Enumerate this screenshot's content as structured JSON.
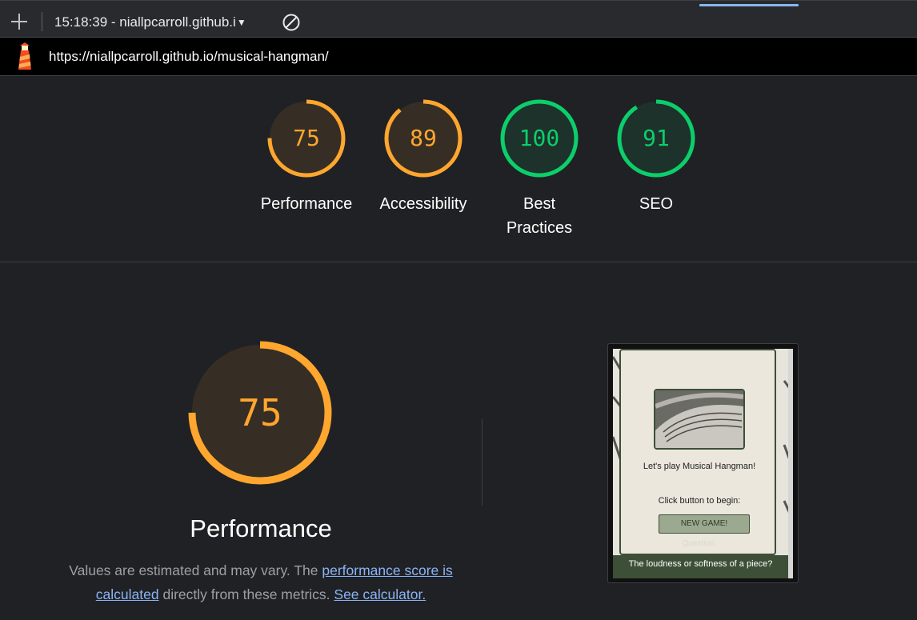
{
  "toolbar": {
    "report_select": "15:18:39 - niallpcarroll.github.i",
    "colors": {
      "accent": "#8ab4f8"
    }
  },
  "urlbar": {
    "url": "https://niallpcarroll.github.io/musical-hangman/"
  },
  "gauges": [
    {
      "score": "75",
      "label": "Performance",
      "color": "#ffa62f",
      "fraction": 0.75
    },
    {
      "score": "89",
      "label": "Accessibility",
      "color": "#ffa62f",
      "fraction": 0.89
    },
    {
      "score": "100",
      "label": "Best Practices",
      "color": "#0cce6b",
      "fraction": 1.0
    },
    {
      "score": "91",
      "label": "SEO",
      "color": "#0cce6b",
      "fraction": 0.91
    }
  ],
  "performance": {
    "score": "75",
    "fraction": 0.75,
    "title": "Performance",
    "desc_1": "Values are estimated and may vary. The ",
    "link_score": "performance score is calculated",
    "desc_2": " directly from these metrics. ",
    "link_calculator": "See calculator."
  },
  "thumbnail": {
    "title": "Let's play Musical Hangman!",
    "begin": "Click button to begin:",
    "button": "NEW GAME!",
    "question_label": "Question:",
    "footer": "The loudness or softness of a piece?"
  }
}
